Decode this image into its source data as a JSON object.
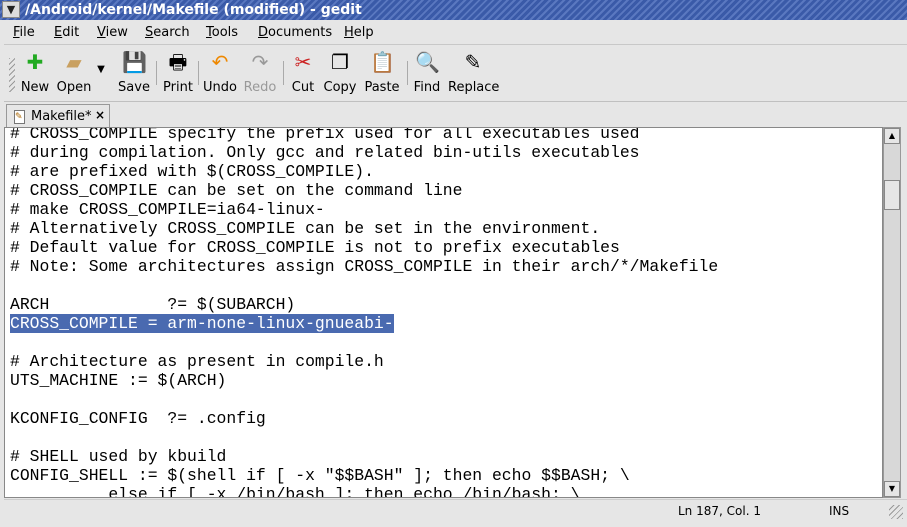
{
  "window": {
    "title": "/Android/kernel/Makefile (modified) - gedit",
    "menu_icon": "chevron-down-icon"
  },
  "menu": [
    "File",
    "Edit",
    "View",
    "Search",
    "Tools",
    "Documents",
    "Help"
  ],
  "toolbar": {
    "new": "New",
    "open": "Open",
    "save": "Save",
    "print": "Print",
    "undo": "Undo",
    "redo": "Redo",
    "cut": "Cut",
    "copy": "Copy",
    "paste": "Paste",
    "find": "Find",
    "replace": "Replace"
  },
  "tab": {
    "label": "Makefile*",
    "close": "×"
  },
  "code": [
    "# CROSS_COMPILE specify the prefix used for all executables used",
    "# during compilation. Only gcc and related bin-utils executables",
    "# are prefixed with $(CROSS_COMPILE).",
    "# CROSS_COMPILE can be set on the command line",
    "# make CROSS_COMPILE=ia64-linux-",
    "# Alternatively CROSS_COMPILE can be set in the environment.",
    "# Default value for CROSS_COMPILE is not to prefix executables",
    "# Note: Some architectures assign CROSS_COMPILE in their arch/*/Makefile",
    "",
    "ARCH            ?= $(SUBARCH)",
    "CROSS_COMPILE = arm-none-linux-gnueabi-",
    "",
    "# Architecture as present in compile.h",
    "UTS_MACHINE := $(ARCH)",
    "",
    "KCONFIG_CONFIG  ?= .config",
    "",
    "# SHELL used by kbuild",
    "CONFIG_SHELL := $(shell if [ -x \"$$BASH\" ]; then echo $$BASH; \\",
    "          else if [ -x /bin/bash ]; then echo /bin/bash; \\"
  ],
  "selected_line": 10,
  "status": {
    "position": "Ln 187, Col. 1",
    "mode": "INS"
  },
  "colors": {
    "selection": "#4a6ab0",
    "titlebar": "#3a5aa8"
  }
}
